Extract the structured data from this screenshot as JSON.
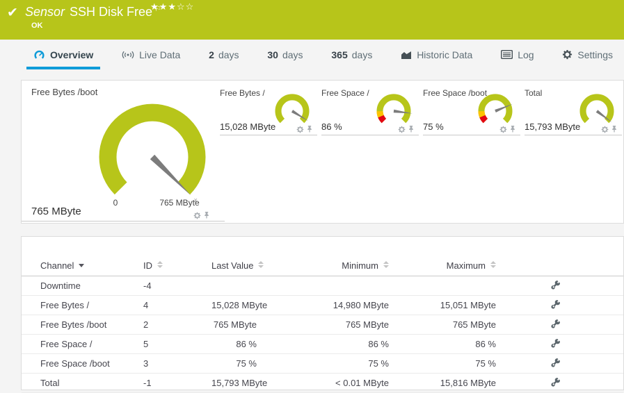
{
  "colors": {
    "green": "#b7c51a",
    "blue": "#0f9bd8",
    "red": "#e30613",
    "yellow": "#fdc300",
    "needle": "#7c7c7c"
  },
  "header": {
    "kind_label": "Sensor",
    "title": "SSH Disk Free",
    "status": "OK",
    "stars_filled": 3,
    "stars_total": 5
  },
  "tabs": [
    {
      "label": "Overview",
      "icon": "gauge-icon",
      "active": true
    },
    {
      "label": "Live Data",
      "icon": "broadcast-icon",
      "active": false
    },
    {
      "prefix": "2",
      "label": "days",
      "active": false
    },
    {
      "prefix": "30",
      "label": "days",
      "active": false
    },
    {
      "prefix": "365",
      "label": "days",
      "active": false
    },
    {
      "label": "Historic Data",
      "icon": "chart-icon",
      "active": false
    },
    {
      "label": "Log",
      "icon": "log-icon",
      "active": false
    },
    {
      "label": "Settings",
      "icon": "gear-icon",
      "active": false
    }
  ],
  "chart_data": {
    "type": "gauge-group",
    "primary": {
      "title": "Free Bytes /boot",
      "value": "765 MByte",
      "scale_min_label": "0",
      "scale_max_label": "765 MByte",
      "fraction": 1.0,
      "tip_marker": "x",
      "segments": []
    },
    "small": [
      {
        "title": "Free Bytes /",
        "value": "15,028 MByte",
        "fraction": 0.95,
        "segments": []
      },
      {
        "title": "Free Space /",
        "value": "86 %",
        "fraction": 0.86,
        "segments": [
          {
            "from": 0,
            "to": 0.085,
            "color": "#e30613"
          },
          {
            "from": 0.085,
            "to": 0.165,
            "color": "#fdc300"
          }
        ]
      },
      {
        "title": "Free Space /boot",
        "value": "75 %",
        "fraction": 0.75,
        "segments": [
          {
            "from": 0,
            "to": 0.085,
            "color": "#e30613"
          },
          {
            "from": 0.085,
            "to": 0.165,
            "color": "#fdc300"
          }
        ]
      },
      {
        "title": "Total",
        "value": "15,793 MByte",
        "fraction": 0.97,
        "segments": []
      }
    ]
  },
  "table": {
    "columns": [
      "Channel",
      "ID",
      "Last Value",
      "Minimum",
      "Maximum"
    ],
    "sorted_column": "Channel",
    "rows": [
      {
        "channel": "Downtime",
        "id": "-4",
        "last": "",
        "min": "",
        "max": ""
      },
      {
        "channel": "Free Bytes /",
        "id": "4",
        "last": "15,028 MByte",
        "min": "14,980 MByte",
        "max": "15,051 MByte"
      },
      {
        "channel": "Free Bytes /boot",
        "id": "2",
        "last": "765 MByte",
        "min": "765 MByte",
        "max": "765 MByte"
      },
      {
        "channel": "Free Space /",
        "id": "5",
        "last": "86 %",
        "min": "86 %",
        "max": "86 %"
      },
      {
        "channel": "Free Space /boot",
        "id": "3",
        "last": "75 %",
        "min": "75 %",
        "max": "75 %"
      },
      {
        "channel": "Total",
        "id": "-1",
        "last": "15,793 MByte",
        "min": "< 0.01 MByte",
        "max": "15,816 MByte"
      }
    ]
  }
}
